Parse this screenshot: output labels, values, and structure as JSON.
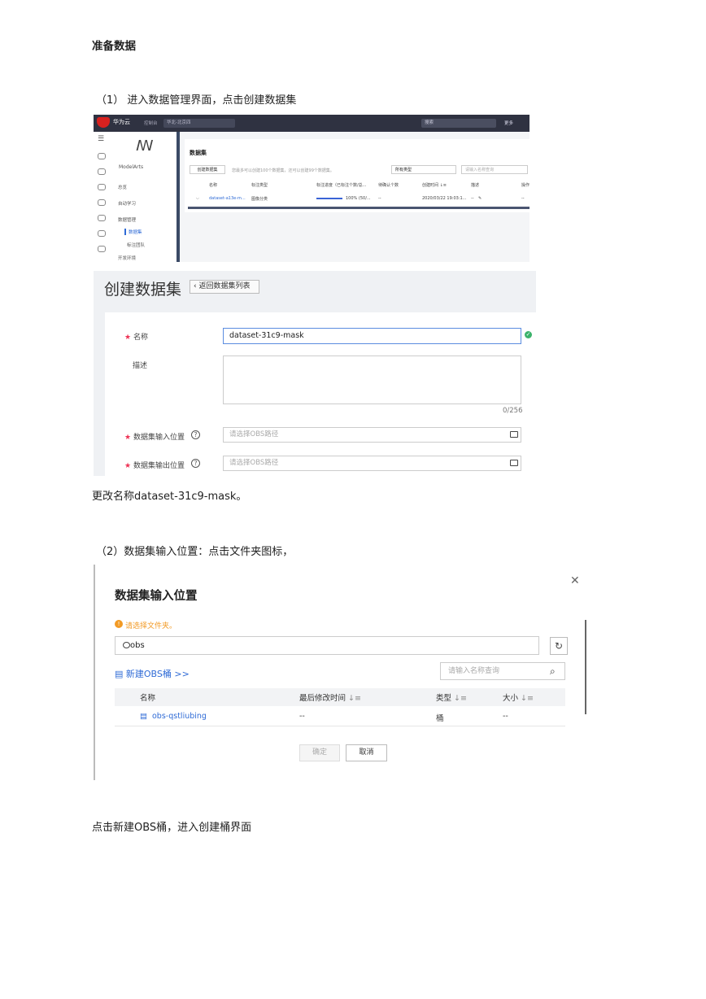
{
  "doc": {
    "heading": "准备数据",
    "step1": "（1） 进入数据管理界面，点击创建数据集",
    "rename_note": "更改名称dataset-31c9-mask。",
    "step2": "（2）数据集输入位置：点击文件夹图标，",
    "final_note": "点击新建OBS桶，进入创建桶界面"
  },
  "console": {
    "brand": "华为云",
    "console_link": "控制台",
    "region": "华北-北京四",
    "search_placeholder": "搜索",
    "more": "更多",
    "product": "ModelArts",
    "menu": [
      "总览",
      "自动学习",
      "数据管理",
      "数据集",
      "标注团队",
      "开发环境"
    ],
    "page_title": "数据集",
    "create_button": "创建数据集",
    "tip": "您最多可以创建100个数据集，还可以创建99个数据集。",
    "type_filter": "所有类型",
    "name_search": "请输入名称查询",
    "columns": [
      "名称",
      "标注类型",
      "标注进度（已标注个数/总...",
      "待确认个数",
      "创建时间 ↓≡",
      "描述",
      "操作"
    ],
    "row": {
      "name": "dataset-a13e-m...",
      "type": "图像分类",
      "progress_pct": 100,
      "progress_text": "100% (50/...",
      "pending": "--",
      "created": "2020/03/22 19:03:1...",
      "desc": "--",
      "op": "--"
    }
  },
  "create_form": {
    "title": "创建数据集",
    "back_button": "返回数据集列表",
    "name_label": "名称",
    "name_value": "dataset-31c9-mask",
    "desc_label": "描述",
    "desc_counter": "0/256",
    "input_label": "数据集输入位置",
    "input_placeholder": "请选择OBS路径",
    "output_label": "数据集输出位置",
    "output_placeholder": "请选择OBS路径"
  },
  "obs_dialog": {
    "title": "数据集输入位置",
    "warning": "请选择文件夹。",
    "path": "obs",
    "new_obs": "新建OBS桶 >>",
    "search_placeholder": "请输入名称查询",
    "columns": {
      "name": "名称",
      "modified": "最后修改时间",
      "type": "类型",
      "size": "大小"
    },
    "rows": [
      {
        "name": "obs-qstliubing",
        "modified": "--",
        "type": "桶",
        "size": "--"
      }
    ],
    "ok_button": "确定",
    "cancel_button": "取消"
  }
}
